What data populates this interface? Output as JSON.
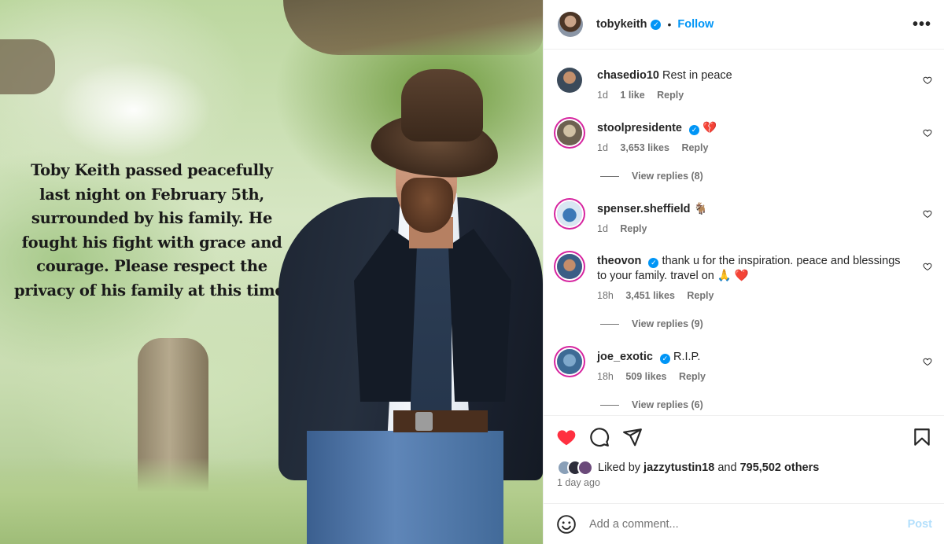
{
  "post": {
    "image_caption": "Toby Keith passed peacefully last night on February 5th, surrounded by his family. He fought his fight with grace and courage. Please respect the privacy of his family at this time."
  },
  "header": {
    "username": "tobykeith",
    "separator": "•",
    "follow_label": "Follow",
    "more_label": "•••"
  },
  "comments": [
    {
      "user": "chasedio10",
      "verified": false,
      "text": "Rest in peace",
      "time": "1d",
      "likes": "1 like",
      "reply": "Reply"
    },
    {
      "user": "stoolpresidente",
      "verified": true,
      "text": "💔",
      "time": "1d",
      "likes": "3,653 likes",
      "reply": "Reply",
      "view_replies": "View replies (8)"
    },
    {
      "user": "spenser.sheffield",
      "verified": false,
      "text": "🐐",
      "time": "1d",
      "reply": "Reply"
    },
    {
      "user": "theovon",
      "verified": true,
      "text": "thank u for the inspiration. peace and blessings to your family. travel on 🙏 ❤️",
      "time": "18h",
      "likes": "3,451 likes",
      "reply": "Reply",
      "view_replies": "View replies (9)"
    },
    {
      "user": "joe_exotic",
      "verified": true,
      "text": "R.I.P.",
      "time": "18h",
      "likes": "509 likes",
      "reply": "Reply",
      "view_replies": "View replies (6)"
    }
  ],
  "likes": {
    "prefix": "Liked by",
    "user": "jazzytustin18",
    "and": "and",
    "others": "795,502 others"
  },
  "time_ago": "1 day ago",
  "add_comment": {
    "placeholder": "Add a comment...",
    "post_label": "Post"
  },
  "colors": {
    "accent": "#0095f6",
    "like_red": "#ff3040",
    "muted": "#737373"
  }
}
